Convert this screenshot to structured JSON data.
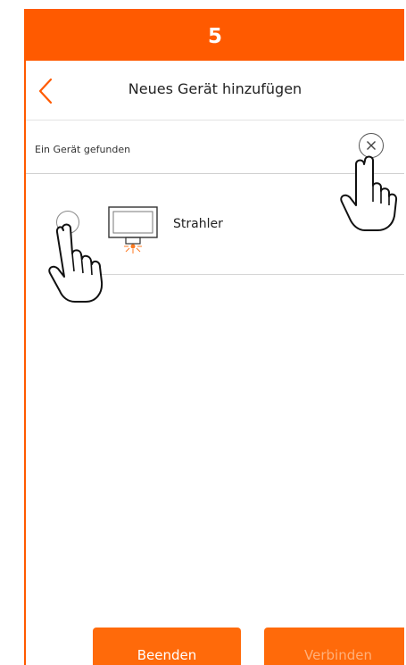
{
  "step_number": "5",
  "header": {
    "title": "Neues Gerät hinzufügen"
  },
  "found": {
    "label": "Ein Gerät gefunden"
  },
  "device": {
    "name": "Strahler"
  },
  "buttons": {
    "finish_label": "Beenden",
    "connect_label": "Verbinden"
  },
  "colors": {
    "accent": "#ff5a00",
    "button": "#ff6a0a",
    "disabled_text": "#ffb07a"
  },
  "icons": {
    "back": "chevron-left-icon",
    "close": "close-icon",
    "device": "floodlight-icon",
    "hand": "pointing-hand-icon"
  }
}
